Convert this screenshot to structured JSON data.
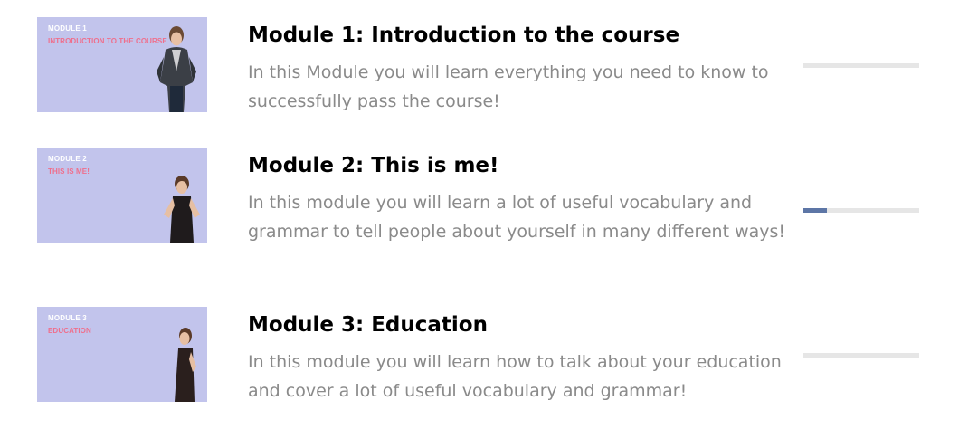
{
  "modules": [
    {
      "thumb_number": "MODULE 1",
      "thumb_subtitle": "INTRODUCTION TO THE COURSE",
      "title": "Module 1: Introduction to the course",
      "description": "In this Module you will learn everything you need to know to successfully pass the course!",
      "progress": 0
    },
    {
      "thumb_number": "MODULE 2",
      "thumb_subtitle": "THIS IS ME!",
      "title": "Module 2: This is me!",
      "description": "In this module you will learn a lot of useful vocabulary and grammar to tell people about yourself in many different ways!",
      "progress": 0.2
    },
    {
      "thumb_number": "MODULE 3",
      "thumb_subtitle": "EDUCATION",
      "title": "Module 3: Education",
      "description": "In this module you will learn how to talk about your education and cover a lot of useful vocabulary and grammar!",
      "progress": 0
    }
  ],
  "colors": {
    "thumb_bg": "#c2c4ec",
    "thumb_subtitle": "#ef6f8c",
    "progress_fill": "#5d76a6",
    "progress_track": "#e6e6e6"
  }
}
